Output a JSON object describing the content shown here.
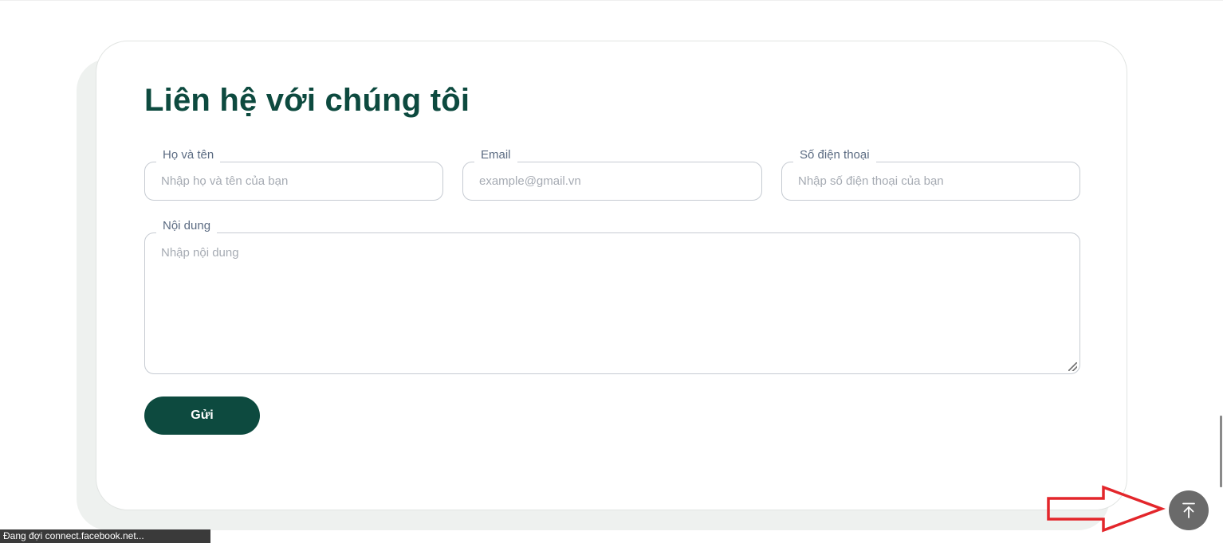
{
  "contact": {
    "title": "Liên hệ với chúng tôi",
    "fields": {
      "name": {
        "label": "Họ và tên",
        "placeholder": "Nhập họ và tên của bạn"
      },
      "email": {
        "label": "Email",
        "placeholder": "example@gmail.vn"
      },
      "phone": {
        "label": "Số điện thoại",
        "placeholder": "Nhập số điện thoại của bạn"
      },
      "message": {
        "label": "Nội dung",
        "placeholder": "Nhập nội dung"
      }
    },
    "submit_label": "Gửi"
  },
  "colors": {
    "brand": "#0d4a3f",
    "annotation": "#e3262b",
    "back_to_top": "#6a6a6a"
  },
  "back_to_top": {
    "icon": "arrow-up-to-line-icon"
  },
  "status_bar": {
    "text": "Đang đợi connect.facebook.net..."
  }
}
